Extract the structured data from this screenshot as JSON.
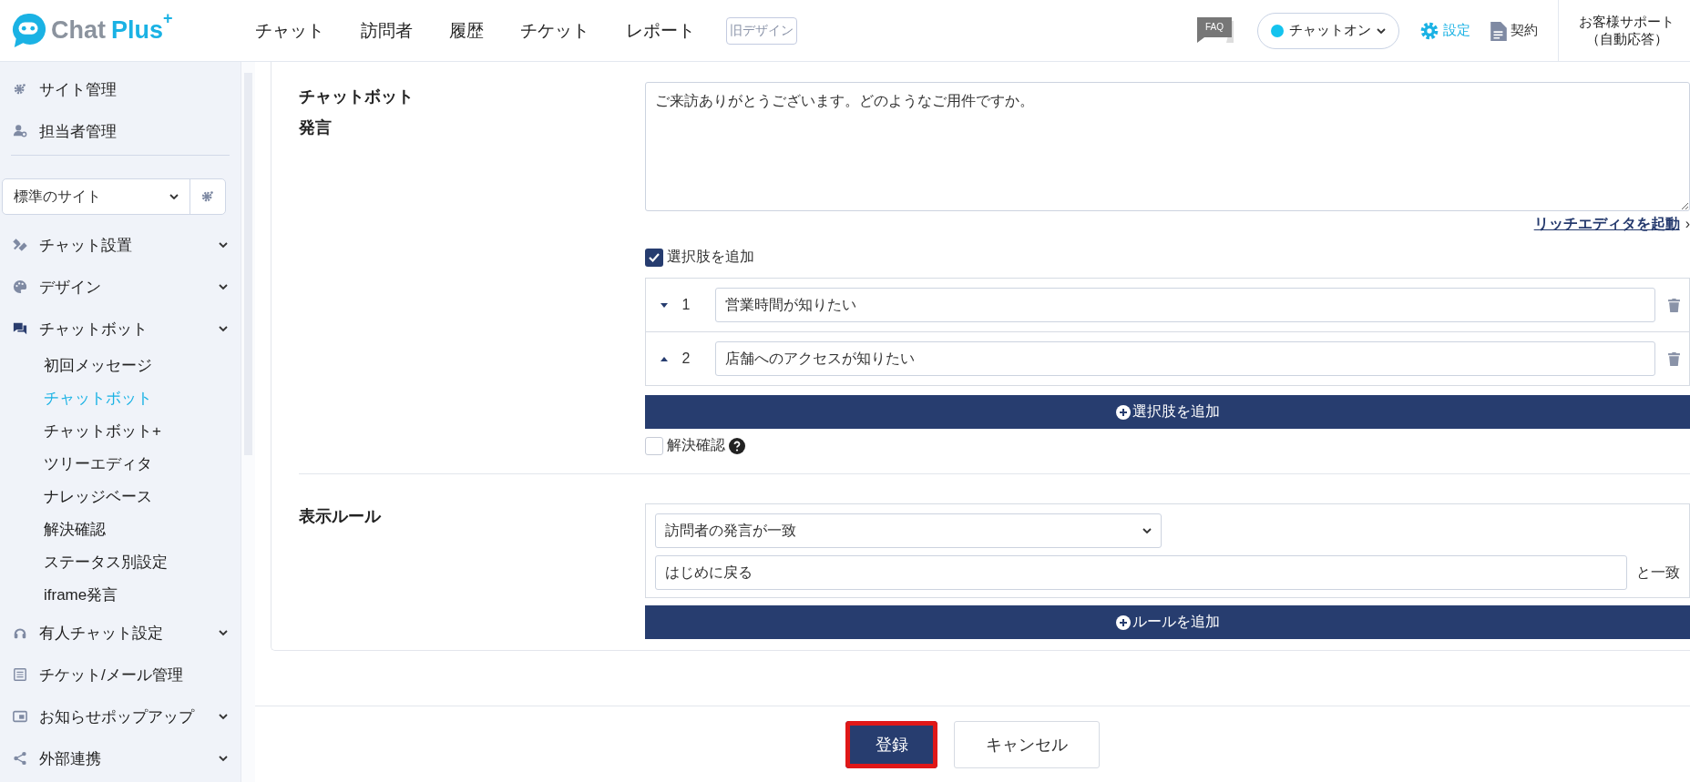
{
  "header": {
    "logo_text": "Chat",
    "logo_accent": "Plus",
    "logo_mark": "+",
    "nav": [
      "チャット",
      "訪問者",
      "履歴",
      "チケット",
      "レポート"
    ],
    "old_design": "旧デザイン",
    "faq": "FAQ",
    "status": {
      "label": "チャットオン",
      "on": true
    },
    "settings": "設定",
    "contract": "契約",
    "support": [
      "お客様サポート",
      "（自動応答）"
    ]
  },
  "sidebar": {
    "top_items": [
      {
        "label": "サイト管理"
      },
      {
        "label": "担当者管理"
      }
    ],
    "site_select": "標準のサイト",
    "menu": [
      {
        "label": "チャット設置",
        "expandable": true
      },
      {
        "label": "デザイン",
        "expandable": true
      },
      {
        "label": "チャットボット",
        "expandable": true,
        "children": [
          {
            "label": "初回メッセージ",
            "selected": false
          },
          {
            "label": "チャットボット",
            "selected": true
          },
          {
            "label": "チャットボット+",
            "selected": false
          },
          {
            "label": "ツリーエディタ",
            "selected": false
          },
          {
            "label": "ナレッジベース",
            "selected": false
          },
          {
            "label": "解決確認",
            "selected": false
          },
          {
            "label": "ステータス別設定",
            "selected": false
          },
          {
            "label": "iframe発言",
            "selected": false
          }
        ]
      },
      {
        "label": "有人チャット設定",
        "expandable": true
      },
      {
        "label": "チケット/メール管理",
        "expandable": false
      },
      {
        "label": "お知らせポップアップ",
        "expandable": true
      },
      {
        "label": "外部連携",
        "expandable": true
      }
    ]
  },
  "form": {
    "message": {
      "label": "チャットボット",
      "sublabel": "発言",
      "value": "ご来訪ありがとうございます。どのようなご用件ですか。",
      "link": "リッチエディタを起動",
      "link_mark": "›"
    },
    "add_choices": {
      "label": "選択肢を追加",
      "checked": true
    },
    "choices": [
      {
        "kind": "down",
        "number": "1",
        "text": "営業時間が知りたい"
      },
      {
        "kind": "up",
        "number": "2",
        "text": "店舗へのアクセスが知りたい"
      }
    ],
    "add_choice_button": "選択肢を追加",
    "resolve": {
      "label": "解決確認",
      "checked": false
    },
    "rule": {
      "label": "表示ルール",
      "condition": "訪問者の発言が一致",
      "value": "はじめに戻る",
      "suffix": "と一致",
      "add_button": "ルールを追加"
    }
  },
  "footer": {
    "submit": {
      "label": "登録",
      "highlighted": true
    },
    "cancel": "キャンセル"
  }
}
